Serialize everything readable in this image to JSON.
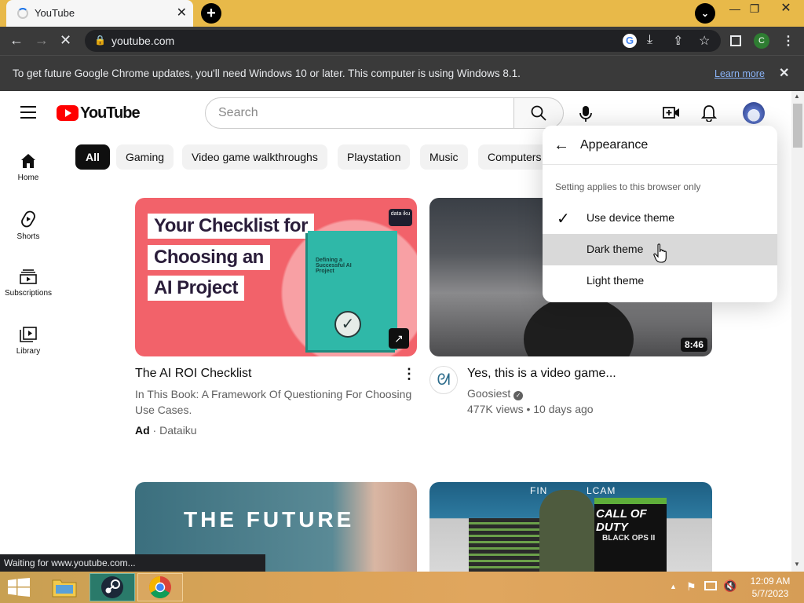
{
  "browser": {
    "tab_title": "YouTube",
    "url": "youtube.com",
    "profile_initial": "C",
    "info_bar_text": "To get future Google Chrome updates, you'll need Windows 10 or later. This computer is using Windows 8.1.",
    "learn_more": "Learn more",
    "status_text": "Waiting for www.youtube.com..."
  },
  "youtube": {
    "logo_text": "YouTube",
    "search_placeholder": "Search",
    "sidebar": [
      {
        "label": "Home",
        "icon": "home-icon"
      },
      {
        "label": "Shorts",
        "icon": "shorts-icon"
      },
      {
        "label": "Subscriptions",
        "icon": "subscriptions-icon"
      },
      {
        "label": "Library",
        "icon": "library-icon"
      }
    ],
    "chips": [
      "All",
      "Gaming",
      "Video game walkthroughs",
      "Playstation",
      "Music",
      "Computers"
    ],
    "videos": [
      {
        "thumb_lines": [
          "Your Checklist for",
          "Choosing an",
          "AI Project"
        ],
        "book_title": "Defining a Successful AI Project",
        "badge": "data iku",
        "title": "The AI ROI Checklist",
        "description": "In This Book: A Framework Of Questioning For Choosing Use Cases.",
        "ad_label": "Ad",
        "channel": "Dataiku"
      },
      {
        "duration": "8:46",
        "title": "Yes, this is a video game...",
        "channel": "Goosiest",
        "stats": "477K views • 10 days ago"
      },
      {
        "thumb_text": "THE FUTURE"
      },
      {
        "thumb_top": "FIN",
        "thumb_top_right": "LCAM",
        "game_title": "CALL OF DUTY",
        "game_sub": "BLACK OPS II"
      }
    ],
    "appearance_menu": {
      "title": "Appearance",
      "note": "Setting applies to this browser only",
      "options": [
        {
          "label": "Use device theme",
          "checked": true
        },
        {
          "label": "Dark theme",
          "checked": false,
          "hovered": true
        },
        {
          "label": "Light theme",
          "checked": false
        }
      ]
    }
  },
  "taskbar": {
    "time": "12:09 AM",
    "date": "5/7/2023"
  },
  "colors": {
    "yt_red": "#ff0000",
    "chrome_dark": "#3a3a3a",
    "title_bar": "#e8b949"
  }
}
